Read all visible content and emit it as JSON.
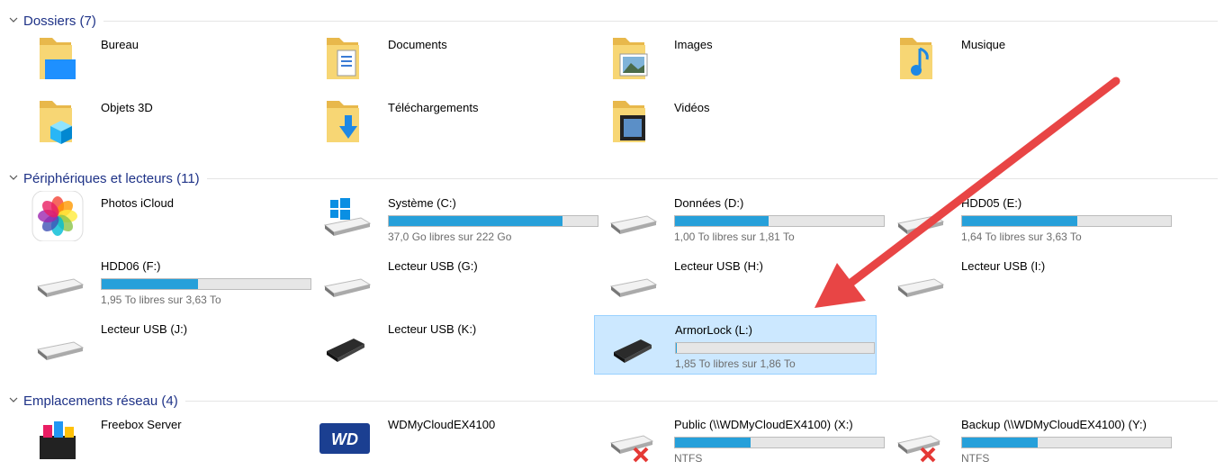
{
  "colors": {
    "group_title": "#1e3287",
    "bar_fill": "#26a0da",
    "selection": "#cce8ff",
    "annotation_arrow": "#e84545"
  },
  "groups": [
    {
      "title": "Dossiers (7)",
      "items": [
        {
          "name": "Bureau",
          "icon": "desktop-folder-icon"
        },
        {
          "name": "Documents",
          "icon": "documents-folder-icon"
        },
        {
          "name": "Images",
          "icon": "images-folder-icon"
        },
        {
          "name": "Musique",
          "icon": "music-folder-icon"
        },
        {
          "name": "Objets 3D",
          "icon": "3d-objects-folder-icon"
        },
        {
          "name": "Téléchargements",
          "icon": "downloads-folder-icon"
        },
        {
          "name": "Vidéos",
          "icon": "videos-folder-icon"
        }
      ]
    },
    {
      "title": "Périphériques et lecteurs (11)",
      "items": [
        {
          "name": "Photos iCloud",
          "icon": "icloud-photos-icon"
        },
        {
          "name": "Système (C:)",
          "icon": "windows-drive-icon",
          "used_fraction": 0.83,
          "sub": "37,0 Go libres sur 222 Go"
        },
        {
          "name": "Données (D:)",
          "icon": "hard-drive-icon",
          "used_fraction": 0.45,
          "sub": "1,00 To libres sur 1,81 To"
        },
        {
          "name": "HDD05 (E:)",
          "icon": "hard-drive-icon",
          "used_fraction": 0.55,
          "sub": "1,64 To libres sur 3,63 To"
        },
        {
          "name": "HDD06 (F:)",
          "icon": "hard-drive-icon",
          "used_fraction": 0.46,
          "sub": "1,95 To libres sur 3,63 To"
        },
        {
          "name": "Lecteur USB (G:)",
          "icon": "usb-drive-icon"
        },
        {
          "name": "Lecteur USB (H:)",
          "icon": "usb-drive-icon"
        },
        {
          "name": "Lecteur USB (I:)",
          "icon": "usb-drive-icon"
        },
        {
          "name": "Lecteur USB (J:)",
          "icon": "usb-drive-icon"
        },
        {
          "name": "Lecteur USB (K:)",
          "icon": "external-drive-icon"
        },
        {
          "name": "ArmorLock (L:)",
          "icon": "external-drive-icon",
          "used_fraction": 0.005,
          "sub": "1,85 To libres sur 1,86 To",
          "selected": true
        }
      ]
    },
    {
      "title": "Emplacements réseau (4)",
      "items": [
        {
          "name": "Freebox Server",
          "icon": "freebox-server-icon"
        },
        {
          "name": "WDMyCloudEX4100",
          "icon": "wd-logo-icon"
        },
        {
          "name": "Public (\\\\WDMyCloudEX4100) (X:)",
          "icon": "network-drive-disconnected-icon",
          "used_fraction": 0.36,
          "sub": "NTFS"
        },
        {
          "name": "Backup (\\\\WDMyCloudEX4100) (Y:)",
          "icon": "network-drive-disconnected-icon",
          "used_fraction": 0.36,
          "sub": "NTFS"
        }
      ]
    }
  ]
}
